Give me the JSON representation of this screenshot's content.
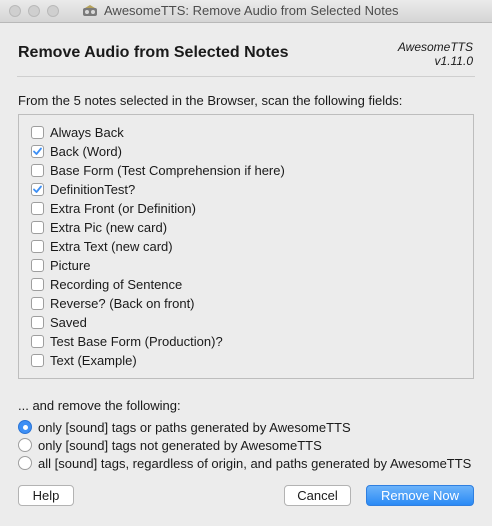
{
  "window": {
    "title": "AwesomeTTS: Remove Audio from Selected Notes"
  },
  "header": {
    "title": "Remove Audio from Selected Notes",
    "brand_name": "AwesomeTTS",
    "brand_version": "v1.11.0"
  },
  "scan_prompt": "From the 5 notes selected in the Browser, scan the following fields:",
  "fields": [
    {
      "label": "Always Back",
      "checked": false
    },
    {
      "label": "Back (Word)",
      "checked": true
    },
    {
      "label": "Base Form (Test Comprehension if here)",
      "checked": false
    },
    {
      "label": "DefinitionTest?",
      "checked": true
    },
    {
      "label": "Extra Front (or Definition)",
      "checked": false
    },
    {
      "label": "Extra Pic (new card)",
      "checked": false
    },
    {
      "label": "Extra Text (new card)",
      "checked": false
    },
    {
      "label": "Picture",
      "checked": false
    },
    {
      "label": "Recording of Sentence",
      "checked": false
    },
    {
      "label": "Reverse? (Back on front)",
      "checked": false
    },
    {
      "label": "Saved",
      "checked": false
    },
    {
      "label": "Test Base Form (Production)?",
      "checked": false
    },
    {
      "label": "Text (Example)",
      "checked": false
    }
  ],
  "remove_prompt": "... and remove the following:",
  "remove_options": [
    {
      "label": "only [sound] tags or paths generated by AwesomeTTS",
      "selected": true
    },
    {
      "label": "only [sound] tags not generated by AwesomeTTS",
      "selected": false
    },
    {
      "label": "all [sound] tags, regardless of origin, and paths generated by AwesomeTTS",
      "selected": false
    }
  ],
  "buttons": {
    "help": "Help",
    "cancel": "Cancel",
    "remove_now": "Remove Now"
  },
  "colors": {
    "accent": "#3d8ff5",
    "checkmark": "#3d8ff5"
  }
}
